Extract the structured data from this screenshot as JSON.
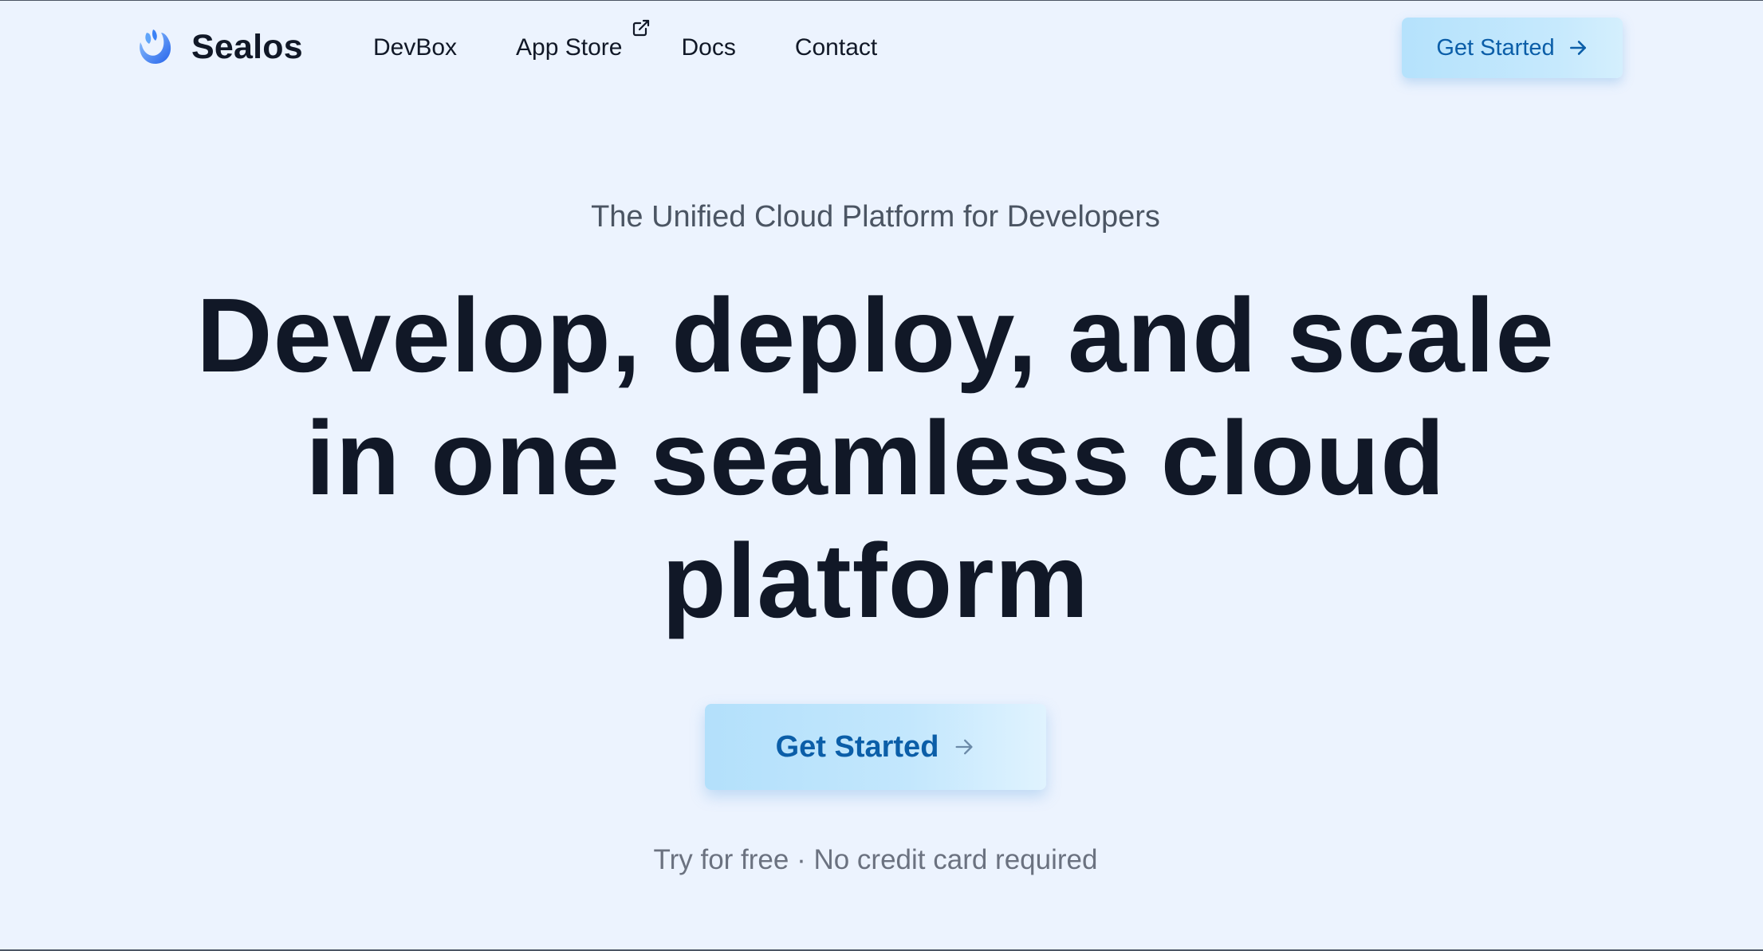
{
  "header": {
    "brand_name": "Sealos",
    "nav": {
      "devbox": "DevBox",
      "app_store": "App Store",
      "docs": "Docs",
      "contact": "Contact"
    },
    "cta_label": "Get Started"
  },
  "hero": {
    "eyebrow": "The Unified Cloud Platform for Developers",
    "headline_line1": "Develop, deploy, and scale",
    "headline_line2": "in one seamless cloud",
    "headline_line3": "platform",
    "cta_label": "Get Started",
    "note": "Try for free · No credit card required"
  },
  "colors": {
    "background": "#ecf3fe",
    "heading_text": "#111827",
    "muted_text": "#4b5563",
    "cta_text": "#0b5ea8",
    "cta_background": "#b5e2fc",
    "logo_blue": "#3b82f6"
  },
  "icons": {
    "logo": "sealos-logo-icon",
    "external_link": "external-link-icon",
    "arrow": "arrow-right-icon"
  }
}
